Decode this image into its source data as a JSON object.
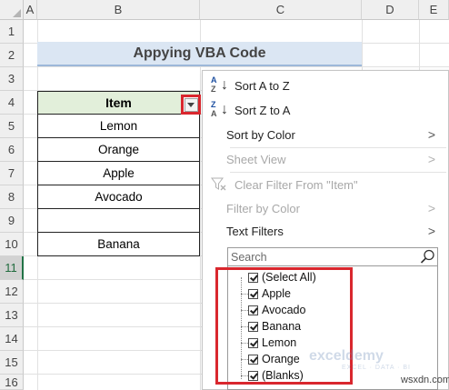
{
  "columns": [
    "A",
    "B",
    "C",
    "D",
    "E"
  ],
  "rows": [
    "1",
    "2",
    "3",
    "4",
    "5",
    "6",
    "7",
    "8",
    "9",
    "10",
    "11",
    "12",
    "13",
    "14",
    "15",
    "16"
  ],
  "selected_row": "11",
  "sheet": {
    "title": "Appying VBA Code",
    "table_header": "Item",
    "items": [
      "Lemon",
      "Orange",
      "Apple",
      "Avocado",
      "",
      "Banana"
    ]
  },
  "menu": {
    "sort_az": "Sort A to Z",
    "sort_za": "Sort Z to A",
    "sort_by_color": "Sort by Color",
    "sheet_view": "Sheet View",
    "clear_filter": "Clear Filter From \"Item\"",
    "filter_by_color": "Filter by Color",
    "text_filters": "Text Filters",
    "search_placeholder": "Search",
    "list": [
      "(Select All)",
      "Apple",
      "Avocado",
      "Banana",
      "Lemon",
      "Orange",
      "(Blanks)"
    ]
  },
  "watermark": {
    "brand": "exceldemy",
    "sub": "EXCEL · DATA · BI",
    "site": "wsxdn.com"
  },
  "colors": {
    "accent_red": "#d9272e",
    "title_bg": "#dbe6f3",
    "header_bg": "#e2efda",
    "selected_row": "#217346"
  }
}
